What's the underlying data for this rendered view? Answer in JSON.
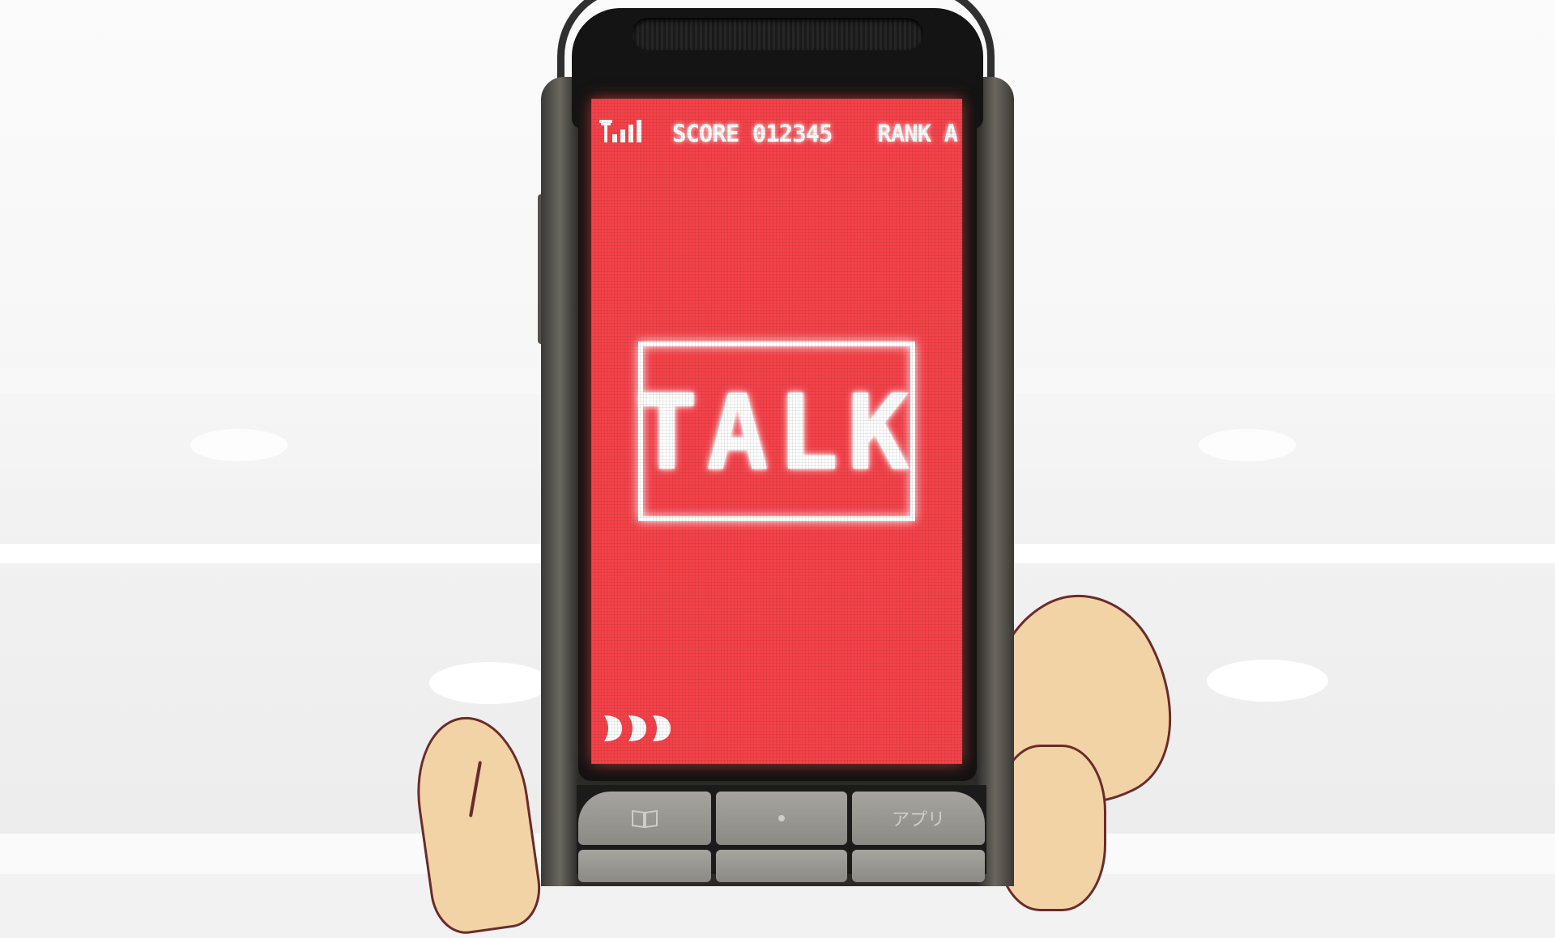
{
  "hud": {
    "score_text": "SCORE 012345",
    "rank_text": "RANK A",
    "signal_icon": "signal-bars-icon"
  },
  "dialog": {
    "label": "TALK"
  },
  "indicator": {
    "icon": "more-arrows-icon",
    "count": 3
  },
  "keypad": {
    "softkey_right": "アプリ"
  },
  "colors": {
    "screen": "#f5424a",
    "text": "#ffffff"
  }
}
